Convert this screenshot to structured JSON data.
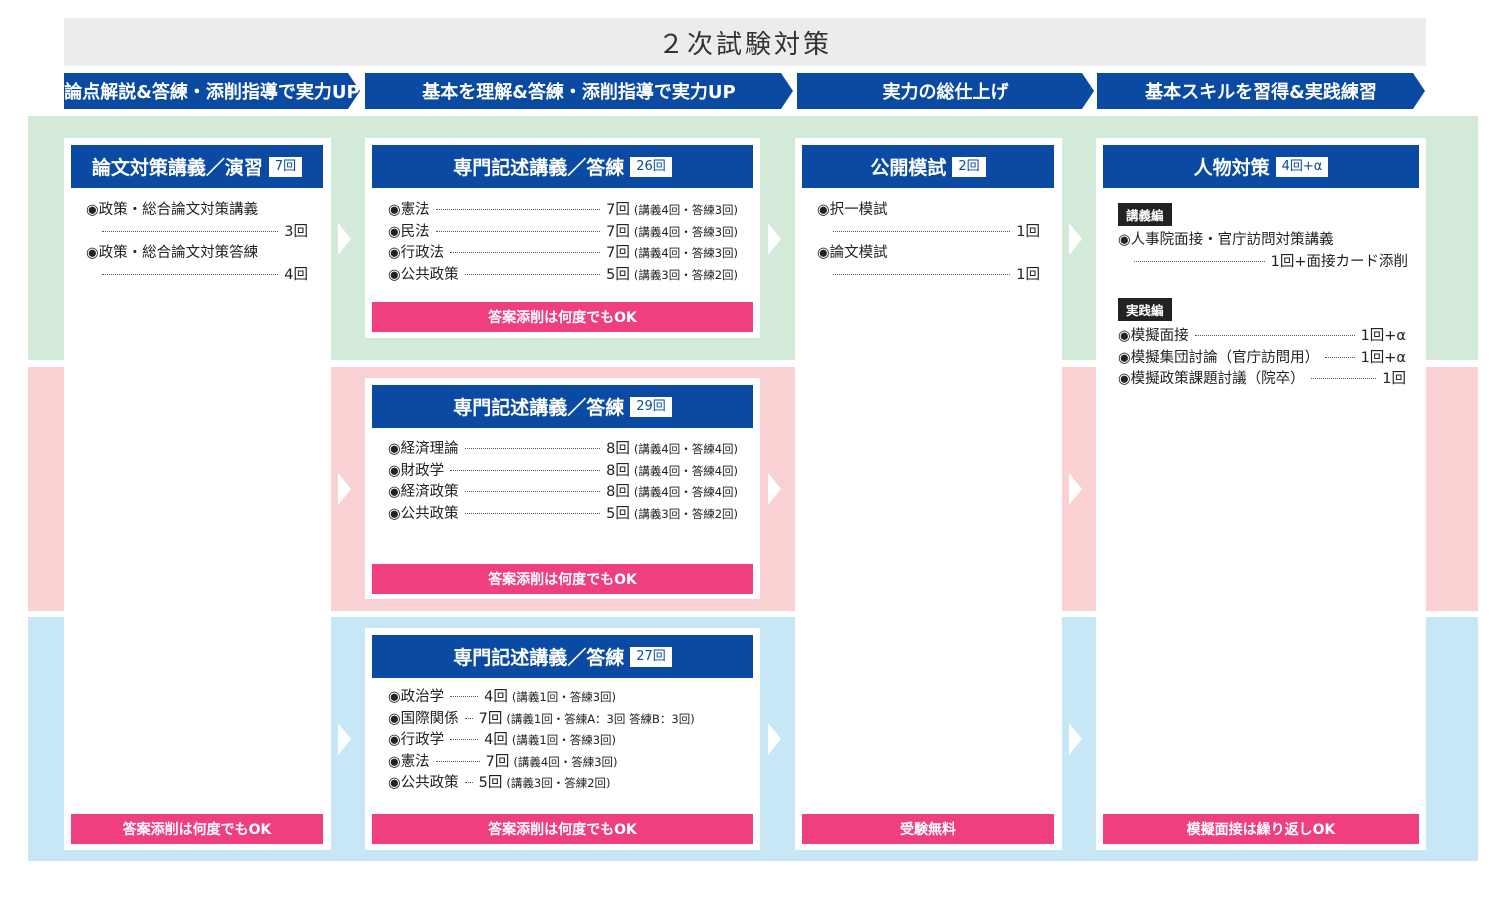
{
  "title": "２次試験対策",
  "phases": [
    "論点解説&答練・添削指導で実力UP",
    "基本を理解&答練・添削指導で実力UP",
    "実力の総仕上げ",
    "基本スキルを習得&実践練習"
  ],
  "colors": {
    "navy": "#0a4aa2",
    "pink_banner": "#ef3f80",
    "green_band": "#d3ead9",
    "pink_band": "#f9d1d2",
    "blue_band": "#c7e6f6"
  },
  "ronbun": {
    "title": "論文対策講義／演習",
    "count": "7回",
    "items": [
      {
        "name": "◉政策・総合論文対策講義",
        "value": "3回"
      },
      {
        "name": "◉政策・総合論文対策答練",
        "value": "4回"
      }
    ],
    "banner": "答案添削は何度でもOK"
  },
  "senmon_green": {
    "title": "専門記述講義／答練",
    "count": "26回",
    "items": [
      {
        "name": "◉憲法",
        "value": "7回",
        "note": "(講義4回・答練3回)"
      },
      {
        "name": "◉民法",
        "value": "7回",
        "note": "(講義4回・答練3回)"
      },
      {
        "name": "◉行政法",
        "value": "7回",
        "note": "(講義4回・答練3回)"
      },
      {
        "name": "◉公共政策",
        "value": "5回",
        "note": "(講義3回・答練2回)"
      }
    ],
    "banner": "答案添削は何度でもOK"
  },
  "senmon_pink": {
    "title": "専門記述講義／答練",
    "count": "29回",
    "items": [
      {
        "name": "◉経済理論",
        "value": "8回",
        "note": "(講義4回・答練4回)"
      },
      {
        "name": "◉財政学",
        "value": "8回",
        "note": "(講義4回・答練4回)"
      },
      {
        "name": "◉経済政策",
        "value": "8回",
        "note": "(講義4回・答練4回)"
      },
      {
        "name": "◉公共政策",
        "value": "5回",
        "note": "(講義3回・答練2回)"
      }
    ],
    "banner": "答案添削は何度でもOK"
  },
  "senmon_blue": {
    "title": "専門記述講義／答練",
    "count": "27回",
    "items": [
      {
        "name": "◉政治学",
        "value": "4回",
        "note": "(講義1回・答練3回)"
      },
      {
        "name": "◉国際関係",
        "value": "7回",
        "note": "(講義1回・答練A：3回 答練B：3回)"
      },
      {
        "name": "◉行政学",
        "value": "4回",
        "note": "(講義1回・答練3回)"
      },
      {
        "name": "◉憲法",
        "value": "7回",
        "note": "(講義4回・答練3回)"
      },
      {
        "name": "◉公共政策",
        "value": "5回",
        "note": "(講義3回・答練2回)"
      }
    ],
    "banner": "答案添削は何度でもOK"
  },
  "moshi": {
    "title": "公開模試",
    "count": "2回",
    "items": [
      {
        "name": "◉択一模試",
        "value": "1回"
      },
      {
        "name": "◉論文模試",
        "value": "1回"
      }
    ],
    "banner": "受験無料"
  },
  "jinbutsu": {
    "title": "人物対策",
    "count": "4回+α",
    "tag_lecture": "講義編",
    "lecture_item": {
      "name": "◉人事院面接・官庁訪問対策講義",
      "value": "1回+面接カード添削"
    },
    "tag_practice": "実践編",
    "practice_items": [
      {
        "name": "◉模擬面接",
        "value": "1回+α"
      },
      {
        "name": "◉模擬集団討論（官庁訪問用）",
        "value": "1回+α"
      },
      {
        "name": "◉模擬政策課題討議（院卒）",
        "value": "1回"
      }
    ],
    "banner": "模擬面接は繰り返しOK"
  }
}
